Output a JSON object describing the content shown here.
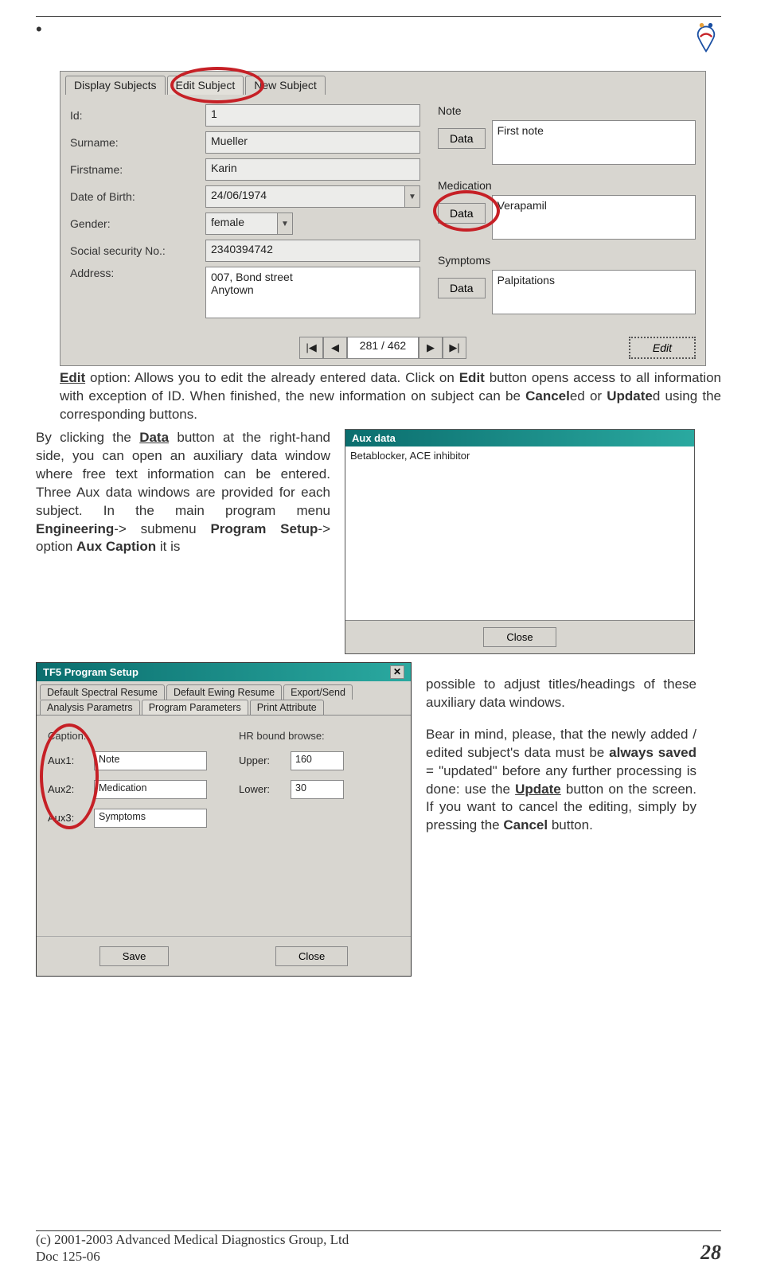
{
  "form": {
    "tabs": {
      "display": "Display Subjects",
      "edit": "Edit Subject",
      "new": "New Subject"
    },
    "labels": {
      "id": "Id:",
      "surname": "Surname:",
      "firstname": "Firstname:",
      "dob": "Date of Birth:",
      "gender": "Gender:",
      "ssn": "Social security No.:",
      "address": "Address:",
      "note": "Note",
      "medication": "Medication",
      "symptoms": "Symptoms",
      "data_btn": "Data"
    },
    "values": {
      "id": "1",
      "surname": "Mueller",
      "firstname": "Karin",
      "dob": "24/06/1974",
      "gender": "female",
      "ssn": "2340394742",
      "address": "007, Bond street\nAnytown",
      "note": "First note",
      "medication": "Verapamil",
      "symptoms": "Palpitations"
    },
    "nav": {
      "first": "|◀",
      "prev": "◀",
      "counter": "281 / 462",
      "next": "▶",
      "last": "▶|",
      "edit_btn": "Edit"
    }
  },
  "text": {
    "p1a": "Edit",
    "p1b": " option:     Allows you to edit the already entered data. Click on ",
    "p1c": "Edit",
    "p1d": " button opens access to all information with exception of ID. When finished, the new information on subject can be ",
    "p1e": "Cancel",
    "p1f": "ed or ",
    "p1g": "Update",
    "p1h": "d using the corresponding buttons.",
    "p2a": "By clicking the ",
    "p2b": "Data",
    "p2c": " button at the right-hand side, you can open an auxiliary data window where free text information can be entered. Three Aux data windows are provided for each subject. In the main program menu ",
    "p2d": "Engineering",
    "p2e": "-> submenu ",
    "p2f": "Program Setup",
    "p2g": "-> option ",
    "p2h": "Aux Caption",
    "p2i": " it is",
    "p3": "possible to adjust titles/headings of these auxiliary data windows.",
    "p4a": "Bear in mind, please, that the newly added / edited subject's data must be ",
    "p4b": "always saved",
    "p4c": " = \"updated\" before any further processing is done: use the ",
    "p4d": "Update",
    "p4e": " button on the screen. If you want to cancel the editing, simply by pressing the ",
    "p4f": "Cancel",
    "p4g": " button."
  },
  "aux": {
    "title": "Aux data",
    "content": "Betablocker, ACE inhibitor",
    "close": "Close"
  },
  "setup": {
    "title": "TF5 Program Setup",
    "tabs": {
      "t1": "Default Spectral Resume",
      "t2": "Default Ewing Resume",
      "t3": "Export/Send",
      "t4": "Analysis Parametrs",
      "t5": "Program Parameters",
      "t6": "Print Attribute"
    },
    "caption_label": "Caption:",
    "aux1": "Aux1:",
    "aux2": "Aux2:",
    "aux3": "Aux3:",
    "aux1v": "Note",
    "aux2v": "Medication",
    "aux3v": "Symptoms",
    "hr_label": "HR bound browse:",
    "upper": "Upper:",
    "lower": "Lower:",
    "upperv": "160",
    "lowerv": "30",
    "save": "Save",
    "close": "Close"
  },
  "footer": {
    "line1": "(c) 2001-2003 Advanced Medical Diagnostics Group, Ltd",
    "line2": "Doc 125-06",
    "page": "28"
  }
}
